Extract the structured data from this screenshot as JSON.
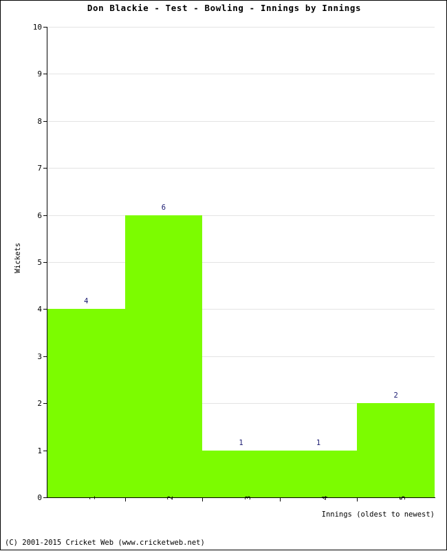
{
  "chart_data": {
    "type": "bar",
    "title": "Don Blackie - Test - Bowling - Innings by Innings",
    "xlabel": "Innings (oldest to newest)",
    "ylabel": "Wickets",
    "categories": [
      "1",
      "2",
      "3",
      "4",
      "5"
    ],
    "values": [
      4,
      6,
      1,
      1,
      2
    ],
    "value_labels": [
      "4",
      "6",
      "1",
      "1",
      "2"
    ],
    "ylim": [
      0,
      10
    ],
    "ytick_labels": [
      "0",
      "1",
      "2",
      "3",
      "4",
      "5",
      "6",
      "7",
      "8",
      "9",
      "10"
    ],
    "ytick_values": [
      0,
      1,
      2,
      3,
      4,
      5,
      6,
      7,
      8,
      9,
      10
    ],
    "grid": true,
    "legend": false,
    "series": [
      {
        "name": "Wickets",
        "values": [
          4,
          6,
          1,
          1,
          2
        ]
      }
    ],
    "colors": {
      "bar": "#7cfc00",
      "value_label": "#191970",
      "gridline": "#e3e3e3",
      "axis": "#000000",
      "background": "#ffffff"
    }
  },
  "footer": {
    "copyright": "(C) 2001-2015 Cricket Web (www.cricketweb.net)"
  }
}
